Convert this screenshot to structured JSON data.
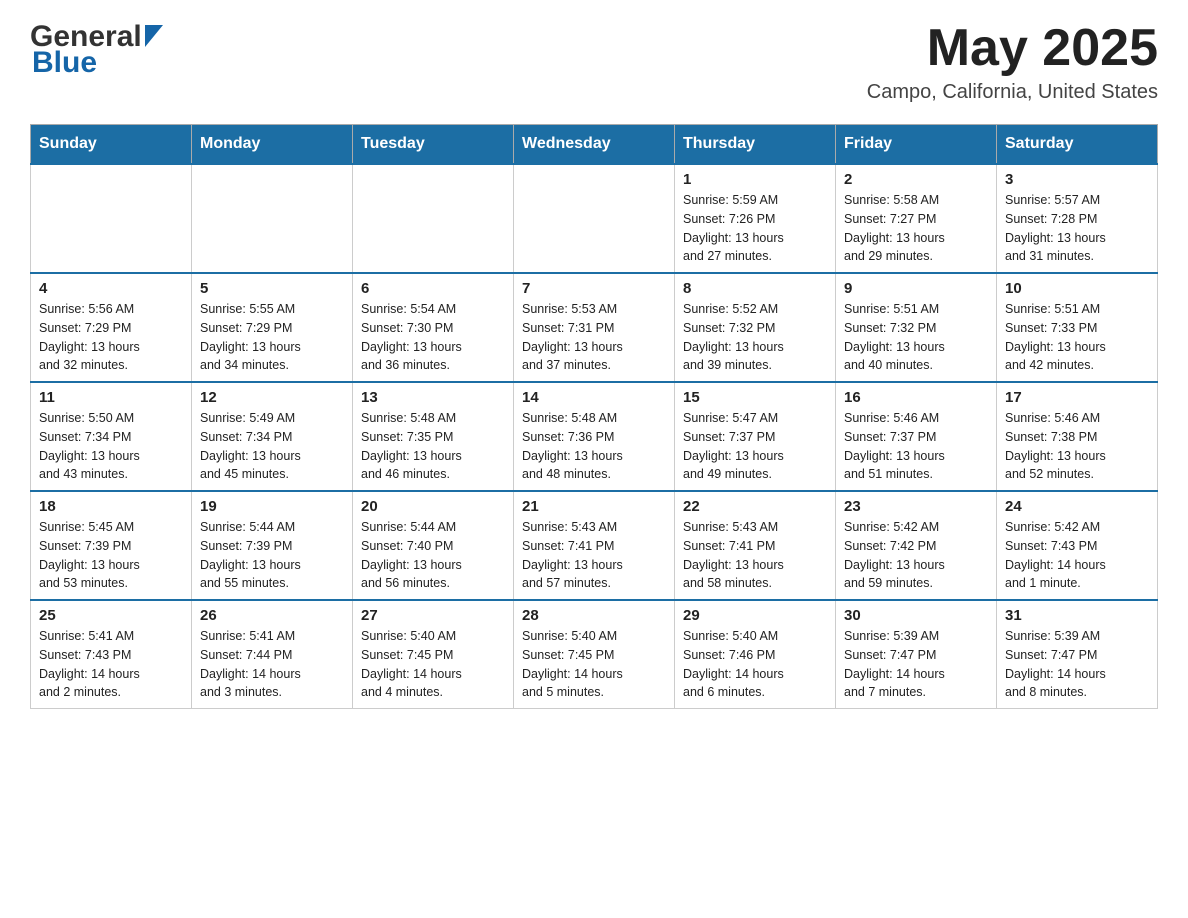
{
  "header": {
    "month_year": "May 2025",
    "location": "Campo, California, United States",
    "logo_general": "General",
    "logo_blue": "Blue"
  },
  "weekdays": [
    "Sunday",
    "Monday",
    "Tuesday",
    "Wednesday",
    "Thursday",
    "Friday",
    "Saturday"
  ],
  "weeks": [
    [
      {
        "day": "",
        "info": ""
      },
      {
        "day": "",
        "info": ""
      },
      {
        "day": "",
        "info": ""
      },
      {
        "day": "",
        "info": ""
      },
      {
        "day": "1",
        "info": "Sunrise: 5:59 AM\nSunset: 7:26 PM\nDaylight: 13 hours\nand 27 minutes."
      },
      {
        "day": "2",
        "info": "Sunrise: 5:58 AM\nSunset: 7:27 PM\nDaylight: 13 hours\nand 29 minutes."
      },
      {
        "day": "3",
        "info": "Sunrise: 5:57 AM\nSunset: 7:28 PM\nDaylight: 13 hours\nand 31 minutes."
      }
    ],
    [
      {
        "day": "4",
        "info": "Sunrise: 5:56 AM\nSunset: 7:29 PM\nDaylight: 13 hours\nand 32 minutes."
      },
      {
        "day": "5",
        "info": "Sunrise: 5:55 AM\nSunset: 7:29 PM\nDaylight: 13 hours\nand 34 minutes."
      },
      {
        "day": "6",
        "info": "Sunrise: 5:54 AM\nSunset: 7:30 PM\nDaylight: 13 hours\nand 36 minutes."
      },
      {
        "day": "7",
        "info": "Sunrise: 5:53 AM\nSunset: 7:31 PM\nDaylight: 13 hours\nand 37 minutes."
      },
      {
        "day": "8",
        "info": "Sunrise: 5:52 AM\nSunset: 7:32 PM\nDaylight: 13 hours\nand 39 minutes."
      },
      {
        "day": "9",
        "info": "Sunrise: 5:51 AM\nSunset: 7:32 PM\nDaylight: 13 hours\nand 40 minutes."
      },
      {
        "day": "10",
        "info": "Sunrise: 5:51 AM\nSunset: 7:33 PM\nDaylight: 13 hours\nand 42 minutes."
      }
    ],
    [
      {
        "day": "11",
        "info": "Sunrise: 5:50 AM\nSunset: 7:34 PM\nDaylight: 13 hours\nand 43 minutes."
      },
      {
        "day": "12",
        "info": "Sunrise: 5:49 AM\nSunset: 7:34 PM\nDaylight: 13 hours\nand 45 minutes."
      },
      {
        "day": "13",
        "info": "Sunrise: 5:48 AM\nSunset: 7:35 PM\nDaylight: 13 hours\nand 46 minutes."
      },
      {
        "day": "14",
        "info": "Sunrise: 5:48 AM\nSunset: 7:36 PM\nDaylight: 13 hours\nand 48 minutes."
      },
      {
        "day": "15",
        "info": "Sunrise: 5:47 AM\nSunset: 7:37 PM\nDaylight: 13 hours\nand 49 minutes."
      },
      {
        "day": "16",
        "info": "Sunrise: 5:46 AM\nSunset: 7:37 PM\nDaylight: 13 hours\nand 51 minutes."
      },
      {
        "day": "17",
        "info": "Sunrise: 5:46 AM\nSunset: 7:38 PM\nDaylight: 13 hours\nand 52 minutes."
      }
    ],
    [
      {
        "day": "18",
        "info": "Sunrise: 5:45 AM\nSunset: 7:39 PM\nDaylight: 13 hours\nand 53 minutes."
      },
      {
        "day": "19",
        "info": "Sunrise: 5:44 AM\nSunset: 7:39 PM\nDaylight: 13 hours\nand 55 minutes."
      },
      {
        "day": "20",
        "info": "Sunrise: 5:44 AM\nSunset: 7:40 PM\nDaylight: 13 hours\nand 56 minutes."
      },
      {
        "day": "21",
        "info": "Sunrise: 5:43 AM\nSunset: 7:41 PM\nDaylight: 13 hours\nand 57 minutes."
      },
      {
        "day": "22",
        "info": "Sunrise: 5:43 AM\nSunset: 7:41 PM\nDaylight: 13 hours\nand 58 minutes."
      },
      {
        "day": "23",
        "info": "Sunrise: 5:42 AM\nSunset: 7:42 PM\nDaylight: 13 hours\nand 59 minutes."
      },
      {
        "day": "24",
        "info": "Sunrise: 5:42 AM\nSunset: 7:43 PM\nDaylight: 14 hours\nand 1 minute."
      }
    ],
    [
      {
        "day": "25",
        "info": "Sunrise: 5:41 AM\nSunset: 7:43 PM\nDaylight: 14 hours\nand 2 minutes."
      },
      {
        "day": "26",
        "info": "Sunrise: 5:41 AM\nSunset: 7:44 PM\nDaylight: 14 hours\nand 3 minutes."
      },
      {
        "day": "27",
        "info": "Sunrise: 5:40 AM\nSunset: 7:45 PM\nDaylight: 14 hours\nand 4 minutes."
      },
      {
        "day": "28",
        "info": "Sunrise: 5:40 AM\nSunset: 7:45 PM\nDaylight: 14 hours\nand 5 minutes."
      },
      {
        "day": "29",
        "info": "Sunrise: 5:40 AM\nSunset: 7:46 PM\nDaylight: 14 hours\nand 6 minutes."
      },
      {
        "day": "30",
        "info": "Sunrise: 5:39 AM\nSunset: 7:47 PM\nDaylight: 14 hours\nand 7 minutes."
      },
      {
        "day": "31",
        "info": "Sunrise: 5:39 AM\nSunset: 7:47 PM\nDaylight: 14 hours\nand 8 minutes."
      }
    ]
  ]
}
